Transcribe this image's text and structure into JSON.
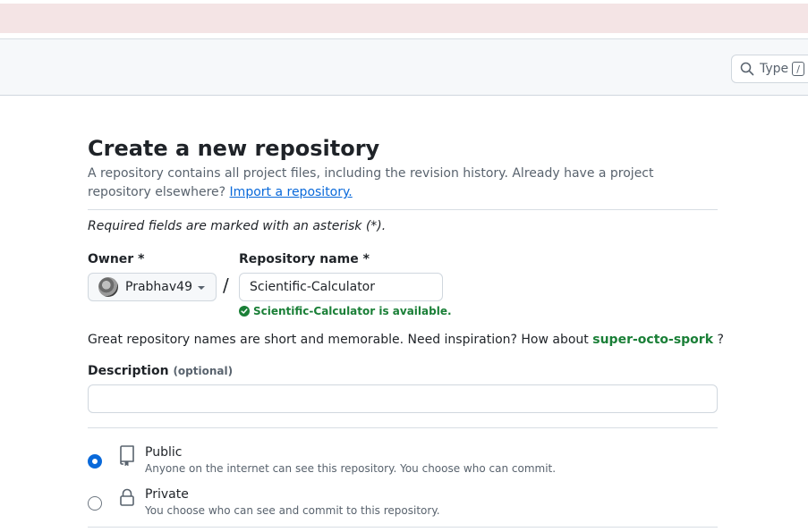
{
  "header": {
    "search": {
      "placeholder": "Type",
      "shortcut": "/"
    }
  },
  "page": {
    "title": "Create a new repository",
    "subtitle_text": "A repository contains all project files, including the revision history. Already have a project repository elsewhere?",
    "import_link": "Import a repository.",
    "required_note": "Required fields are marked with an asterisk (*)."
  },
  "owner": {
    "label": "Owner *",
    "value": "Prabhav49"
  },
  "separator": "/",
  "repo_name": {
    "label": "Repository name *",
    "value": "Scientific-Calculator",
    "availability": "Scientific-Calculator is available."
  },
  "inspiration": {
    "text": "Great repository names are short and memorable. Need inspiration? How about",
    "suggestion": "super-octo-spork",
    "suffix": "?"
  },
  "description": {
    "label": "Description",
    "optional": "(optional)",
    "value": ""
  },
  "visibility": {
    "public": {
      "title": "Public",
      "desc": "Anyone on the internet can see this repository. You choose who can commit.",
      "selected": true
    },
    "private": {
      "title": "Private",
      "desc": "You choose who can see and commit to this repository.",
      "selected": false
    }
  },
  "colors": {
    "accent": "#0969da",
    "success": "#1a7f37",
    "banner": "#f4e4e5"
  },
  "icons": {
    "search": "search-icon",
    "public": "repo-icon",
    "private": "lock-icon",
    "check": "check-circle-icon",
    "caret": "triangle-down-icon"
  }
}
